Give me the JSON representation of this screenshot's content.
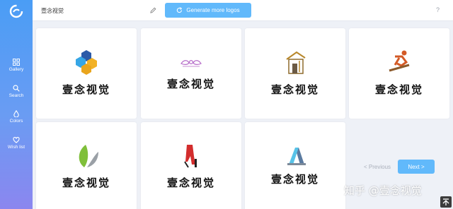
{
  "sidebar": {
    "items": [
      {
        "label": "Gallery",
        "icon": "grid-icon"
      },
      {
        "label": "Search",
        "icon": "search-icon"
      },
      {
        "label": "Colors",
        "icon": "drop-icon"
      },
      {
        "label": "Wish list",
        "icon": "heart-icon"
      }
    ]
  },
  "topbar": {
    "brand_name": "壹念视觉",
    "generate_label": "Generate more logos",
    "help": "?"
  },
  "cards": [
    {
      "brand": "壹念视觉",
      "emblem": "stacked-cubes-icon"
    },
    {
      "brand": "壹念视觉",
      "emblem": "ornament-icon"
    },
    {
      "brand": "壹念视觉",
      "emblem": "house-icon"
    },
    {
      "brand": "壹念视觉",
      "emblem": "skier-icon"
    },
    {
      "brand": "壹念视觉",
      "emblem": "leaf-icon"
    },
    {
      "brand": "壹念视觉",
      "emblem": "high-heel-icon"
    },
    {
      "brand": "壹念视觉",
      "emblem": "letter-a-icon"
    }
  ],
  "pager": {
    "prev": "< Previous",
    "next": "Next >"
  },
  "watermark": "知乎 @壹念视觉",
  "colors": {
    "accent": "#61b9fb",
    "sidebar_top": "#4a9df5",
    "sidebar_bottom": "#8b86ef"
  }
}
